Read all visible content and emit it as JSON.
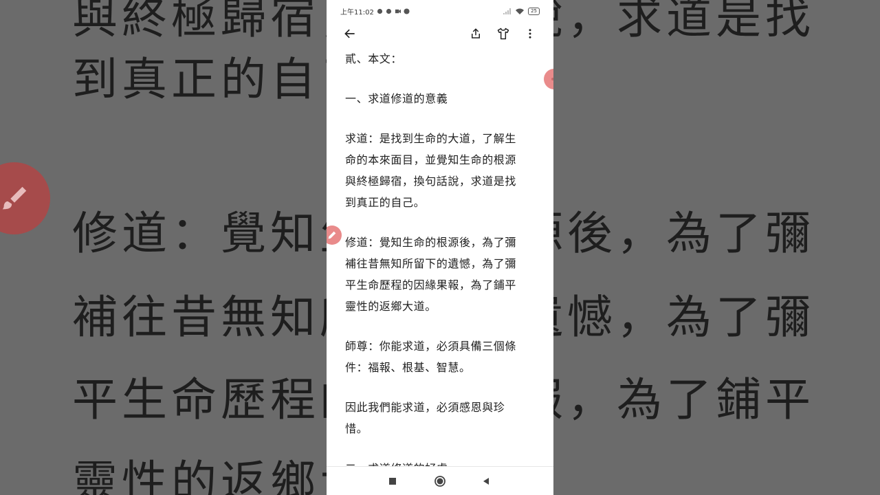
{
  "status_bar": {
    "time": "上午11:02",
    "battery": "25"
  },
  "toolbar": {
    "back_icon": "arrow-left-icon",
    "share_icon": "share-icon",
    "shirt_icon": "shirt-icon",
    "more_icon": "more-vert-icon"
  },
  "article": {
    "paragraphs": [
      "貳、本文：",
      "一、求道修道的意義",
      "求道：是找到生命的大道，了解生\n命的本來面目，並覺知生命的根源\n與終極歸宿，換句話說，求道是找\n到真正的自己。",
      "修道：覺知生命的根源後，為了彌\n補往昔無知所留下的遺憾，為了彌\n平生命歷程的因緣果報，為了鋪平\n靈性的返鄉大道。",
      "師尊：你能求道，必須具備三個條\n件：福報、根基、智慧。",
      "因此我們能求道，必須感恩與珍\n惜。",
      "二、求道修道的好處"
    ]
  },
  "background": {
    "lines": [
      "與終極歸宿，換句話說，求道是找",
      "到真正的自己。",
      "修道：覺知生命的根源後，為了彌",
      "補往昔無知所留下的遺憾，為了彌",
      "平生命歷程的因緣果報，為了鋪平",
      "靈性的返鄉大道。"
    ]
  },
  "navbar": {
    "recents_icon": "square-icon",
    "home_icon": "circle-icon",
    "back_icon": "triangle-back-icon"
  },
  "colors": {
    "backdrop": "#6b6b6b",
    "fab": "#e98b8b"
  }
}
